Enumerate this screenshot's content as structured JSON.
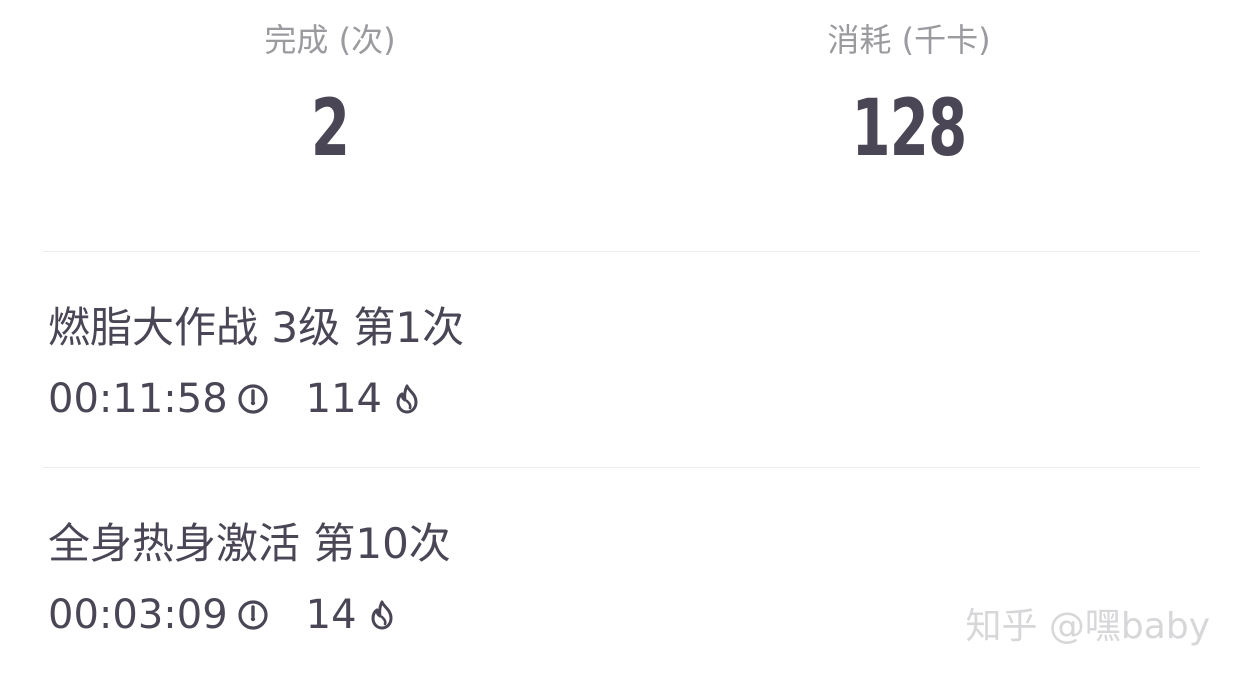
{
  "summary": {
    "completed": {
      "label": "完成 (次)",
      "value": "2"
    },
    "calories": {
      "label": "消耗 (千卡)",
      "value": "128"
    }
  },
  "records": [
    {
      "title": "燃脂大作战 3级  第1次",
      "duration": "00:11:58",
      "calories": "114",
      "duration_icon": "timer-icon",
      "calories_icon": "flame-icon"
    },
    {
      "title": "全身热身激活  第10次",
      "duration": "00:03:09",
      "calories": "14",
      "duration_icon": "timer-icon",
      "calories_icon": "flame-icon"
    }
  ],
  "watermark": "知乎 @嘿baby",
  "colors": {
    "primary_text": "#4a4655",
    "secondary_text": "#9a9a9f",
    "divider": "#ececec",
    "watermark": "#d7d7da"
  }
}
